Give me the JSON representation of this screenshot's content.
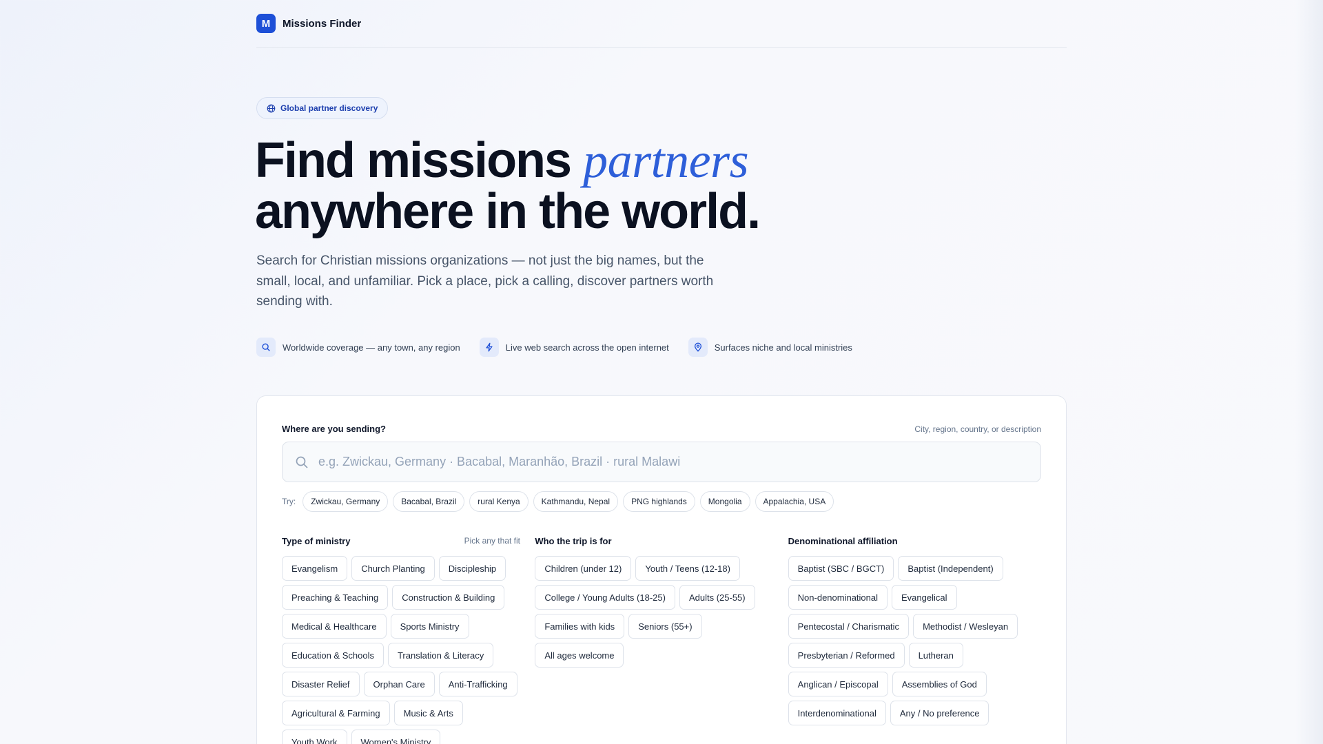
{
  "brand": {
    "logo_letter": "M",
    "name": "Missions Finder"
  },
  "badge": {
    "label": "Global partner discovery",
    "icon": "globe-icon"
  },
  "hero": {
    "title_part1": "Find missions ",
    "title_accent": "partners",
    "title_part2": "anywhere in the world.",
    "subtitle": "Search for Christian missions organizations — not just the big names, but the small, local, and unfamiliar. Pick a place, pick a calling, discover partners worth sending with."
  },
  "features": [
    {
      "icon": "search-icon",
      "label": "Worldwide coverage — any town, any region"
    },
    {
      "icon": "lightning-icon",
      "label": "Live web search across the open internet"
    },
    {
      "icon": "map-pin-icon",
      "label": "Surfaces niche and local ministries"
    }
  ],
  "search": {
    "label": "Where are you sending?",
    "hint": "City, region, country, or description",
    "placeholder": "e.g. Zwickau, Germany · Bacabal, Maranhão, Brazil · rural Malawi",
    "value": ""
  },
  "try": {
    "label": "Try:",
    "chips": [
      "Zwickau, Germany",
      "Bacabal, Brazil",
      "rural Kenya",
      "Kathmandu, Nepal",
      "PNG highlands",
      "Mongolia",
      "Appalachia, USA"
    ]
  },
  "filters": {
    "ministry": {
      "title": "Type of ministry",
      "hint": "Pick any that fit",
      "options": [
        "Evangelism",
        "Church Planting",
        "Discipleship",
        "Preaching & Teaching",
        "Construction & Building",
        "Medical & Healthcare",
        "Sports Ministry",
        "Education & Schools",
        "Translation & Literacy",
        "Disaster Relief",
        "Orphan Care",
        "Anti-Trafficking",
        "Agricultural & Farming",
        "Music & Arts",
        "Youth Work",
        "Women's Ministry"
      ]
    },
    "audience": {
      "title": "Who the trip is for",
      "options": [
        "Children (under 12)",
        "Youth / Teens (12-18)",
        "College / Young Adults (18-25)",
        "Adults (25-55)",
        "Families with kids",
        "Seniors (55+)",
        "All ages welcome"
      ]
    },
    "denomination": {
      "title": "Denominational affiliation",
      "options": [
        "Baptist (SBC / BGCT)",
        "Baptist (Independent)",
        "Non-denominational",
        "Evangelical",
        "Pentecostal / Charismatic",
        "Methodist / Wesleyan",
        "Presbyterian / Reformed",
        "Lutheran",
        "Anglican / Episcopal",
        "Assemblies of God",
        "Interdenominational",
        "Any / No preference"
      ]
    }
  },
  "colors": {
    "accent": "#1d4fd7",
    "accent_text": "#2e5fd9",
    "ink": "#0b1120",
    "muted": "#475569"
  }
}
